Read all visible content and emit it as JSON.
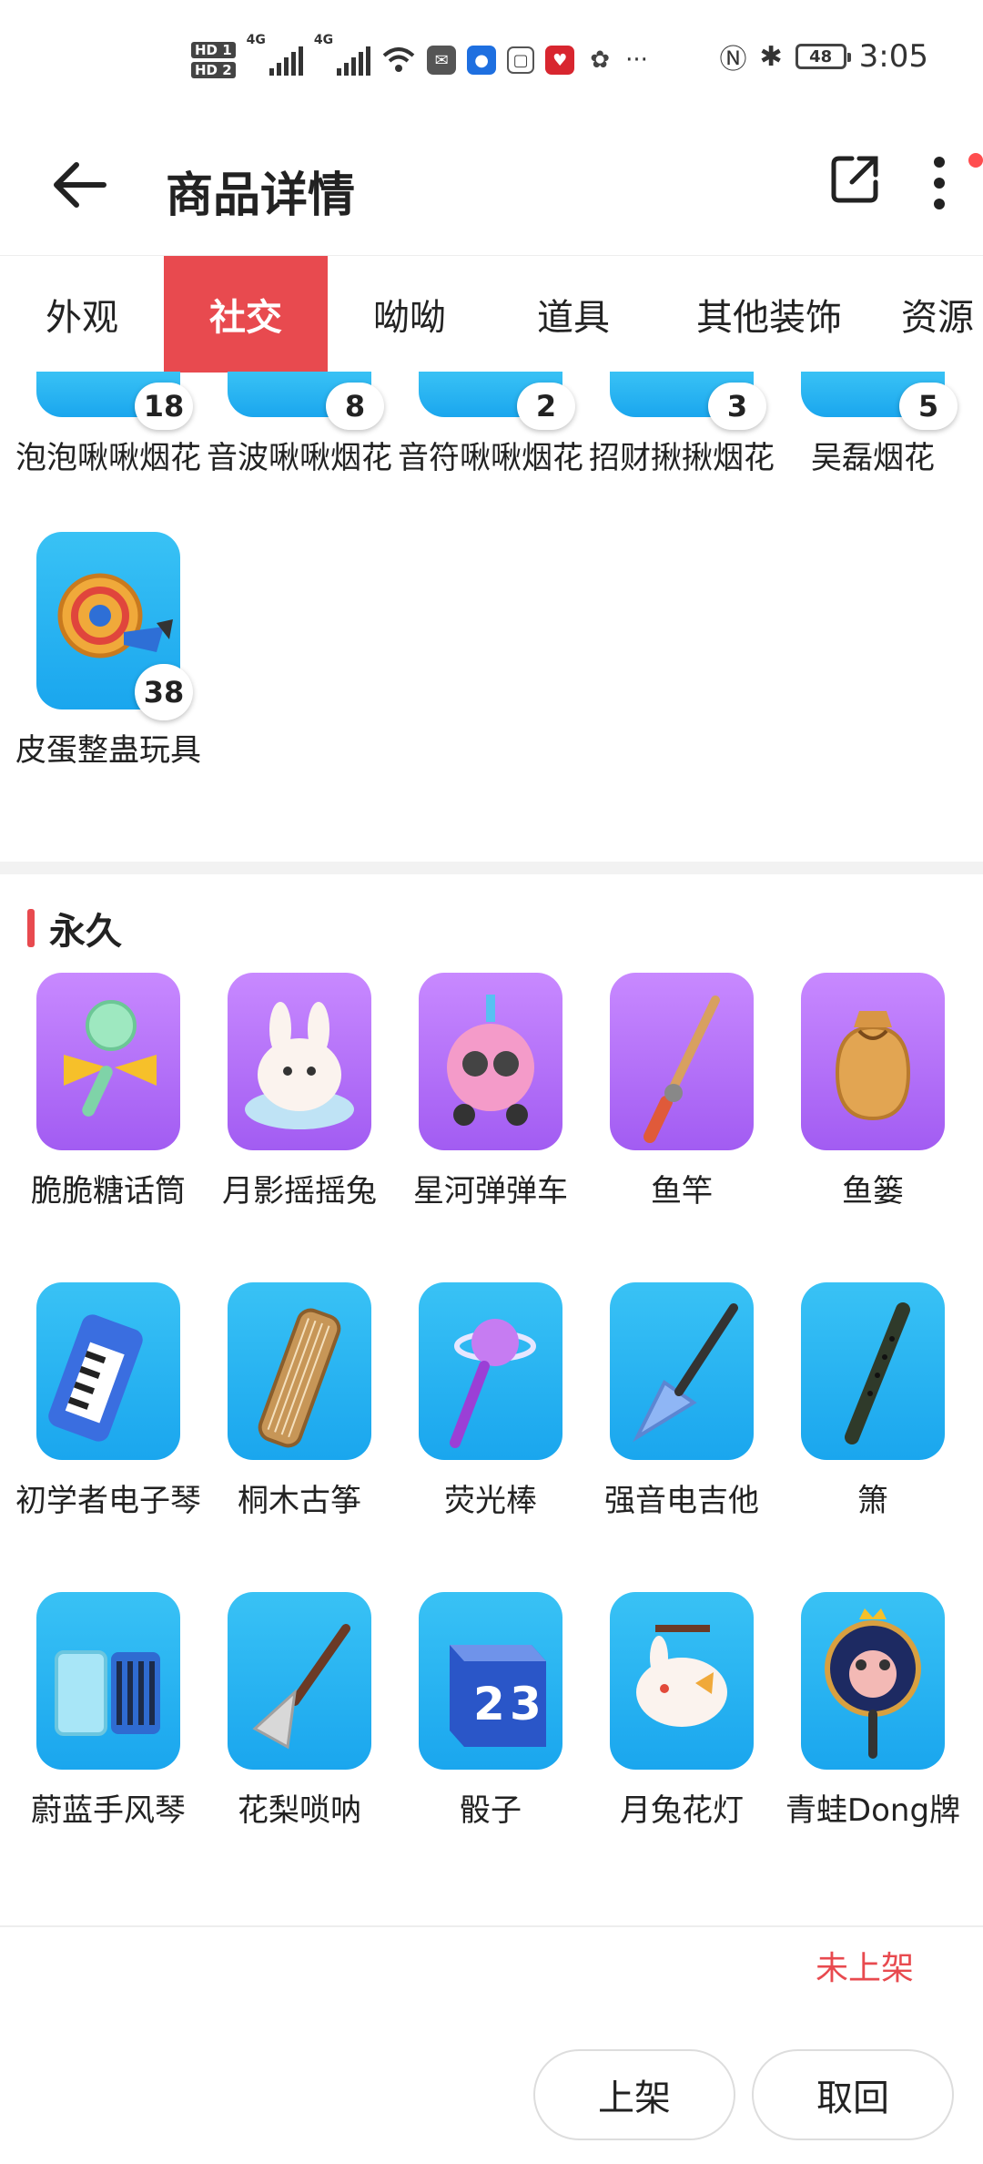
{
  "status_bar": {
    "hd1": "HD 1",
    "hd2": "HD 2",
    "net1": "4G",
    "net2": "4G",
    "more": "···",
    "battery": "48",
    "time": "3:05"
  },
  "header": {
    "title": "商品详情"
  },
  "tabs": [
    {
      "label": "外观",
      "active": false
    },
    {
      "label": "社交",
      "active": true
    },
    {
      "label": "呦呦",
      "active": false
    },
    {
      "label": "道具",
      "active": false
    },
    {
      "label": "其他装饰",
      "active": false
    },
    {
      "label": "资源",
      "active": false
    }
  ],
  "timed_items": [
    {
      "name": "泡泡啾啾烟花",
      "count": "18"
    },
    {
      "name": "音波啾啾烟花",
      "count": "8"
    },
    {
      "name": "音符啾啾烟花",
      "count": "2"
    },
    {
      "name": "招财揪揪烟花",
      "count": "3"
    },
    {
      "name": "吴磊烟花",
      "count": "5"
    },
    {
      "name": "皮蛋整蛊玩具",
      "count": "38"
    }
  ],
  "permanent_section": {
    "title": "永久",
    "items": [
      {
        "name": "脆脆糖话筒",
        "bg": "purple",
        "icon": "microphone-icon"
      },
      {
        "name": "月影摇摇兔",
        "bg": "purple",
        "icon": "rabbit-icon"
      },
      {
        "name": "星河弹弹车",
        "bg": "purple",
        "icon": "robot-car-icon"
      },
      {
        "name": "鱼竿",
        "bg": "purple",
        "icon": "fishing-rod-icon"
      },
      {
        "name": "鱼篓",
        "bg": "purple",
        "icon": "fish-basket-icon"
      },
      {
        "name": "初学者电子琴",
        "bg": "blue",
        "icon": "keyboard-icon"
      },
      {
        "name": "桐木古筝",
        "bg": "blue",
        "icon": "guzheng-icon"
      },
      {
        "name": "荧光棒",
        "bg": "blue",
        "icon": "glowstick-icon"
      },
      {
        "name": "强音电吉他",
        "bg": "blue",
        "icon": "guitar-icon"
      },
      {
        "name": "箫",
        "bg": "blue",
        "icon": "flute-icon"
      },
      {
        "name": "蔚蓝手风琴",
        "bg": "blue",
        "icon": "accordion-icon"
      },
      {
        "name": "花梨唢呐",
        "bg": "blue",
        "icon": "suona-icon"
      },
      {
        "name": "骰子",
        "bg": "blue",
        "icon": "dice-icon"
      },
      {
        "name": "月兔花灯",
        "bg": "blue",
        "icon": "rabbit-lantern-icon"
      },
      {
        "name": "青蛙Dong牌",
        "bg": "blue",
        "icon": "frog-sign-icon"
      }
    ]
  },
  "footer": {
    "status": "未上架",
    "list_button": "上架",
    "cancel_button": "取回"
  },
  "colors": {
    "accent": "#e84a4f",
    "card_blue": "#1aa6ee",
    "card_purple": "#a25cf2"
  }
}
